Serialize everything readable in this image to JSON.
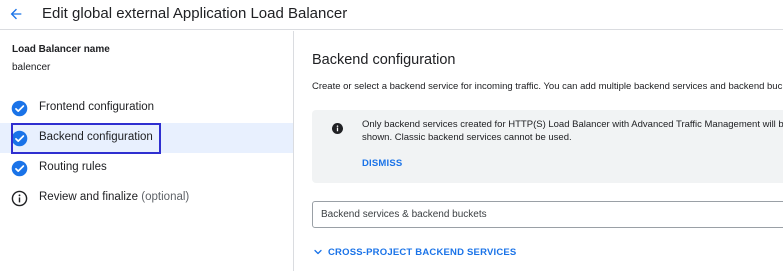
{
  "header": {
    "title": "Edit global external Application Load Balancer",
    "back_icon": "arrow-back-icon"
  },
  "sidebar": {
    "lb_name_label": "Load Balancer name",
    "lb_name_value": "balencer",
    "steps": [
      {
        "label": "Frontend configuration",
        "icon": "check-circle-icon",
        "status": "complete"
      },
      {
        "label": "Backend configuration",
        "icon": "check-circle-icon",
        "status": "complete",
        "active": true
      },
      {
        "label": "Routing rules",
        "icon": "check-circle-icon",
        "status": "complete"
      },
      {
        "label": "Review and finalize",
        "optional_label": "(optional)",
        "icon": "info-outline-icon",
        "status": "info"
      }
    ]
  },
  "main": {
    "title": "Backend configuration",
    "description": "Create or select a backend service for incoming traffic. You can add multiple backend services and backend buckets.",
    "info": {
      "icon": "info-filled-icon",
      "text": "Only backend services created for HTTP(S) Load Balancer with Advanced Traffic Management will be shown. Classic backend services cannot be used.",
      "dismiss_label": "DISMISS"
    },
    "backend_select": {
      "placeholder": "Backend services & backend buckets"
    },
    "cross_project_label": "CROSS-PROJECT BACKEND SERVICES"
  },
  "colors": {
    "accent": "#1a73e8",
    "active_step_bg": "#e8f0fe",
    "highlight_border": "#2f2fd0",
    "info_bg": "#f1f3f4"
  }
}
